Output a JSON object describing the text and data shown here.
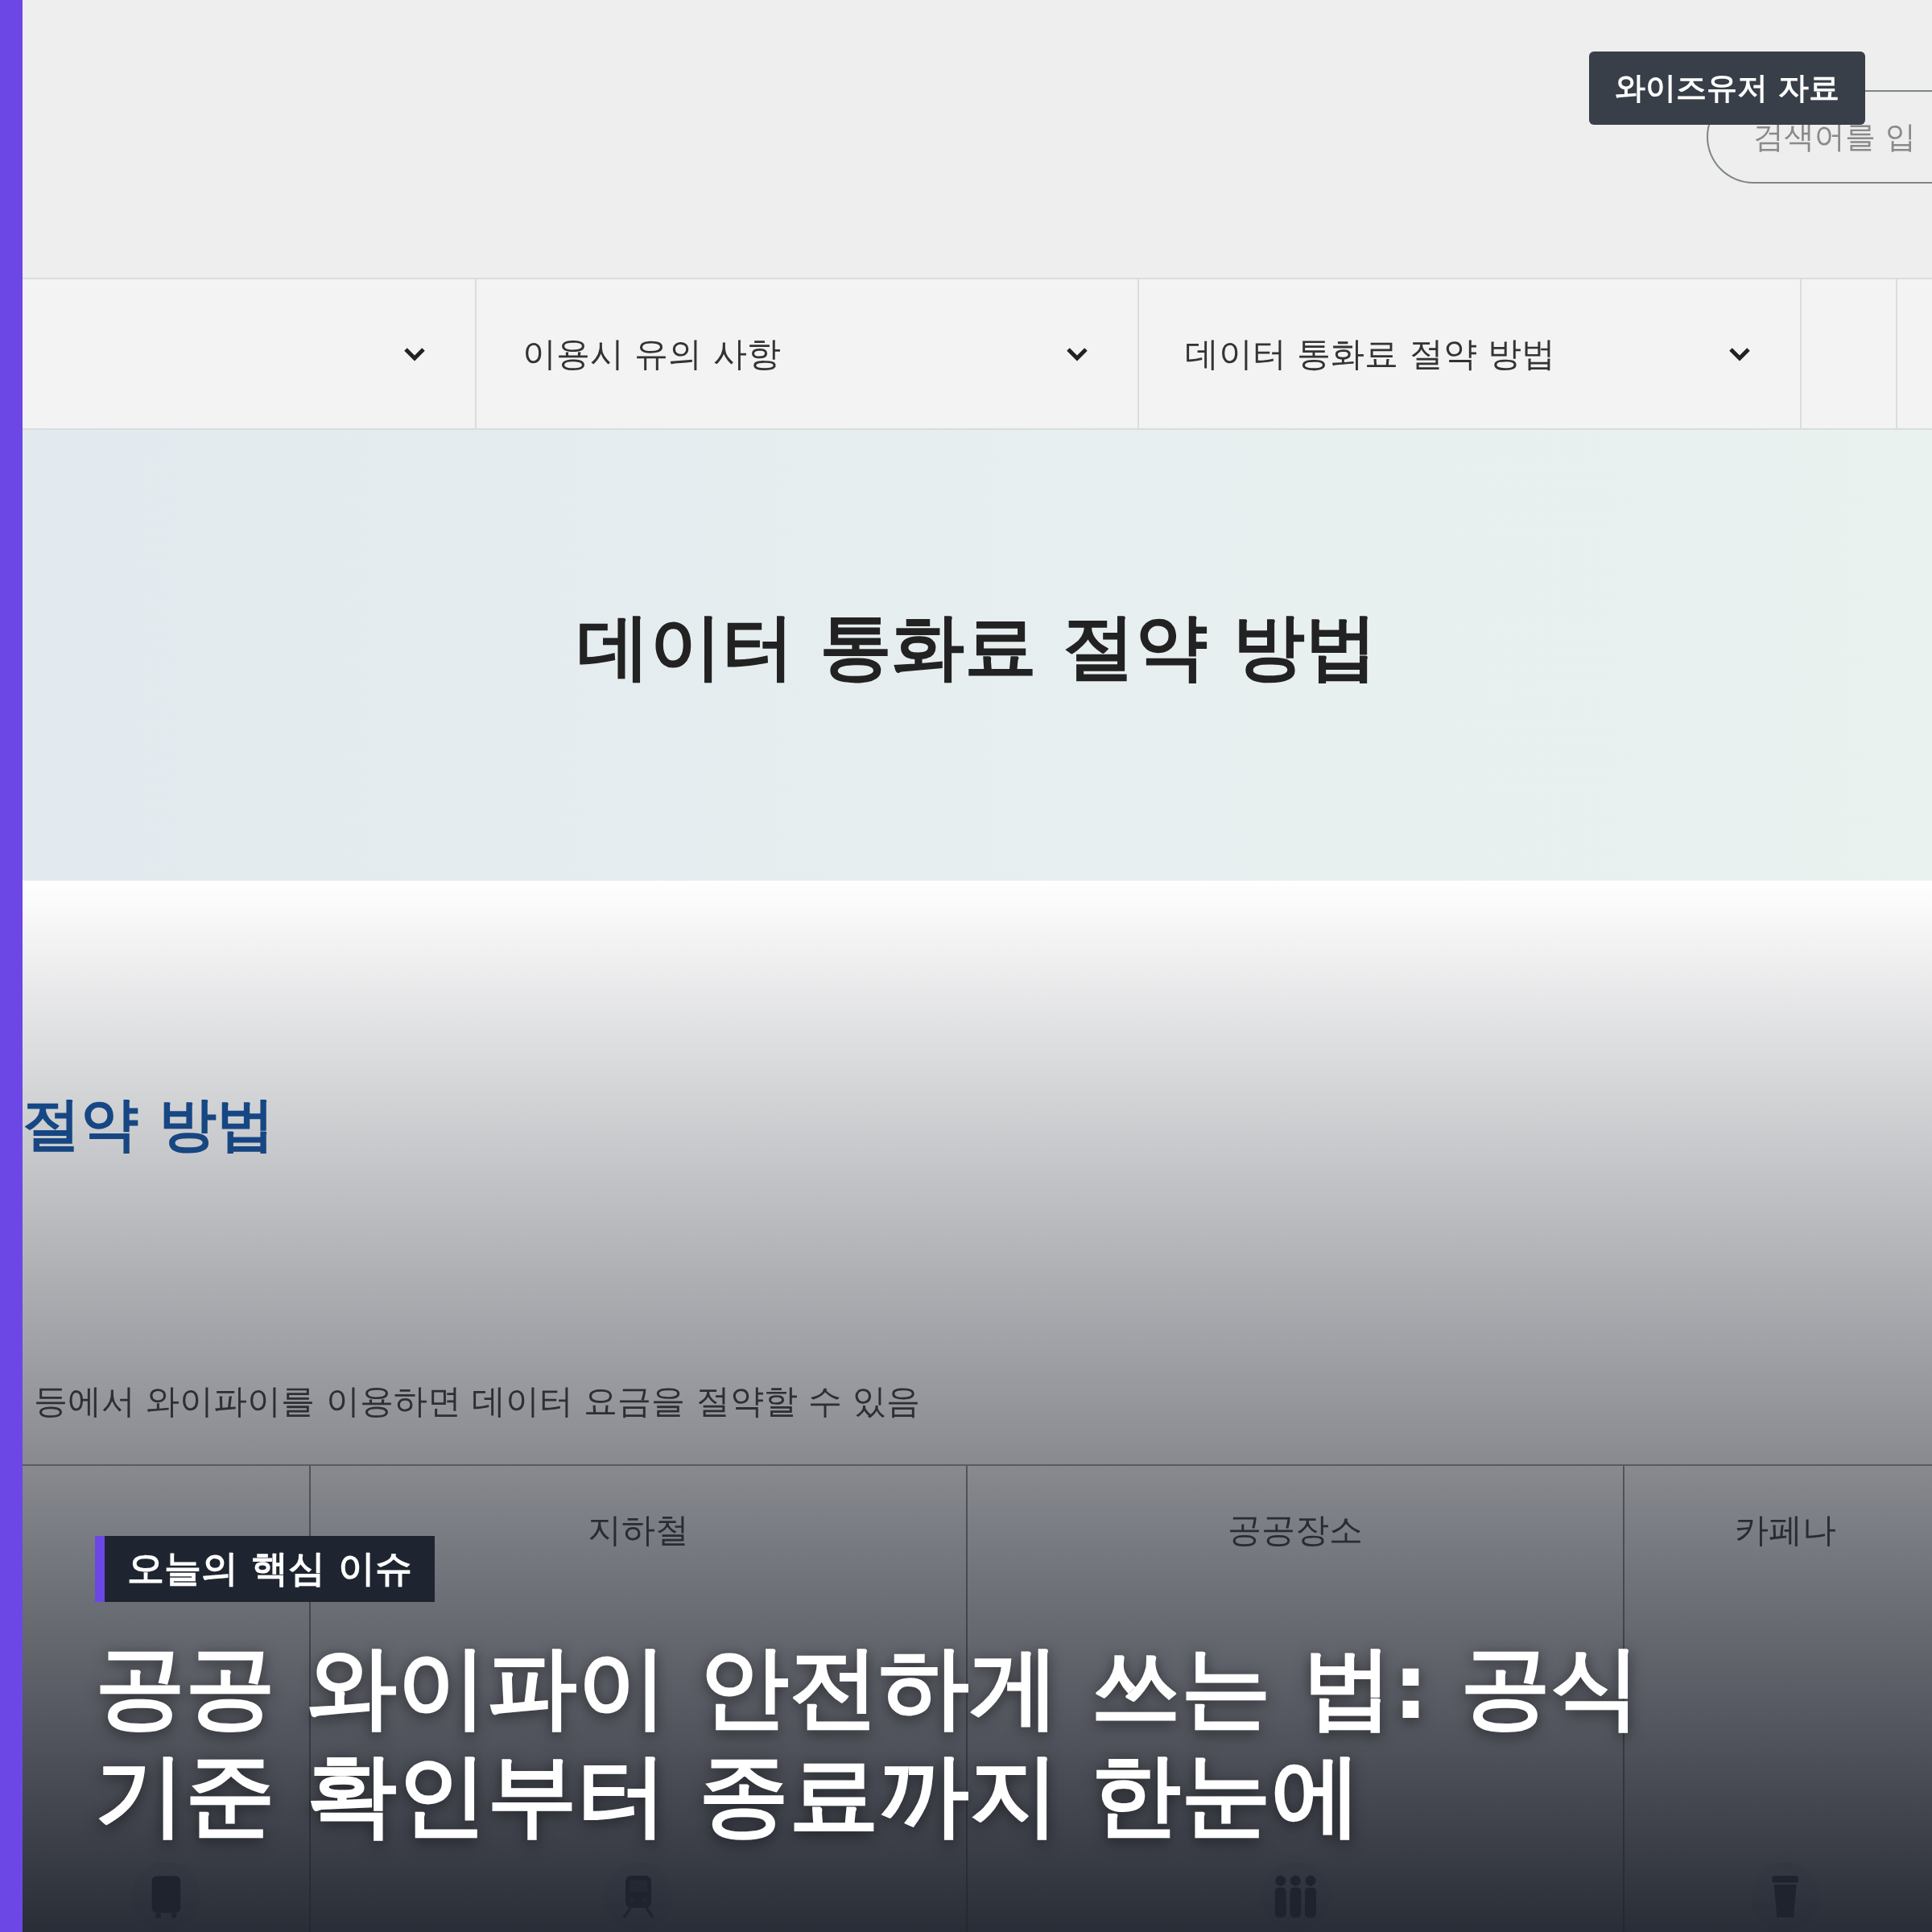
{
  "header": {
    "tooltip": "와이즈유저 자료",
    "search": {
      "placeholder": "검색어를 입"
    }
  },
  "nav": {
    "items": [
      {
        "label": "이용시 유의 사항"
      },
      {
        "label": "데이터 통화료 절약 방법"
      }
    ]
  },
  "hero": {
    "title": "데이터 통화료 절약 방법"
  },
  "section": {
    "heading": "절약 방법",
    "description": "등에서 와이파이를 이용하면 데이터 요금을 절약할 수 있음",
    "columns": [
      {
        "kind": "bus"
      },
      {
        "kind": "train",
        "label": "지하철"
      },
      {
        "kind": "people",
        "label": "공공장소"
      },
      {
        "kind": "cup",
        "label": "카페나"
      }
    ]
  },
  "overlay": {
    "badge": "오늘의 핵심 이슈",
    "headline": "공공 와이파이 안전하게 쓰는 법: 공식 기준 확인부터 종료까지 한눈에"
  }
}
